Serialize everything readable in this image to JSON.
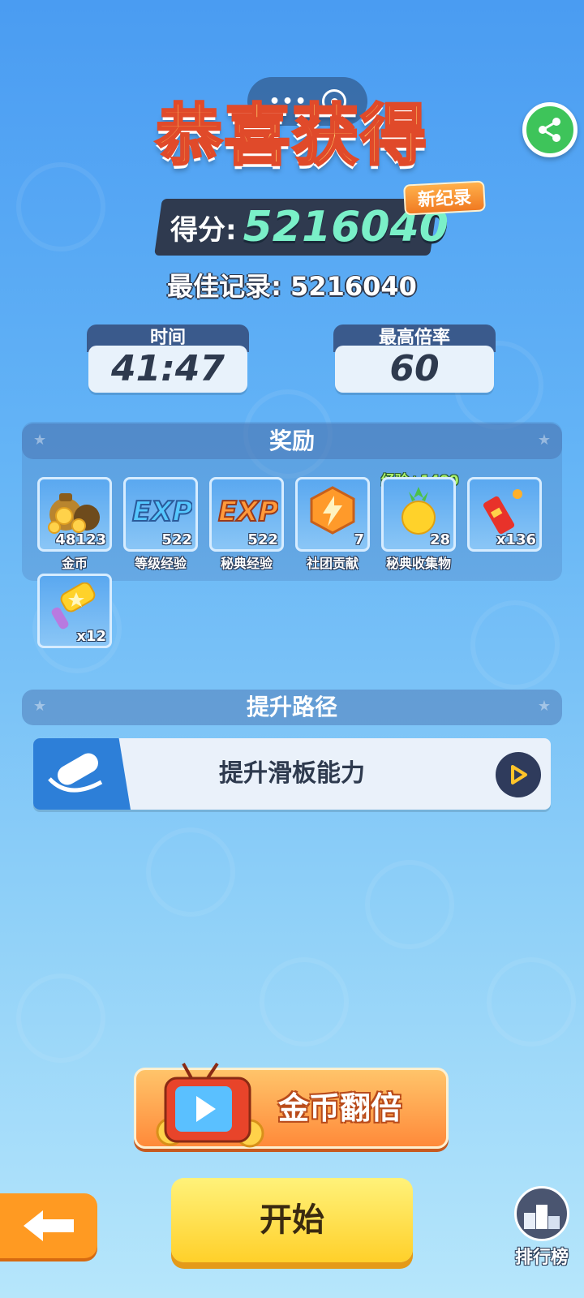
{
  "header": {
    "title": "恭喜获得"
  },
  "score": {
    "label": "得分:",
    "value": "5216040",
    "new_record_badge": "新纪录",
    "best_text": "最佳记录: 5216040"
  },
  "stats": [
    {
      "label": "时间",
      "value": "41:47"
    },
    {
      "label": "最高倍率",
      "value": "60"
    }
  ],
  "rewards": {
    "title": "奖励",
    "bonus_tag": "经验+1400",
    "items": [
      {
        "icon": "coin-bag-icon",
        "count": "48123",
        "label": "金币"
      },
      {
        "icon": "exp-blue-icon",
        "count": "522",
        "label": "等级经验",
        "icon_text": "EXP"
      },
      {
        "icon": "exp-orange-icon",
        "count": "522",
        "label": "秘典经验",
        "icon_text": "EXP"
      },
      {
        "icon": "lightning-badge-icon",
        "count": "7",
        "label": "社团贡献"
      },
      {
        "icon": "pineapple-icon",
        "count": "28",
        "label": "秘典收集物"
      },
      {
        "icon": "firecracker-icon",
        "count": "x136",
        "label": ""
      },
      {
        "icon": "hammer-icon",
        "count": "x12",
        "label": ""
      }
    ]
  },
  "upgrade": {
    "title": "提升路径",
    "card_label": "提升滑板能力"
  },
  "buttons": {
    "double_coins": "金币翻倍",
    "start": "开始",
    "leaderboard": "排行榜"
  },
  "colors": {
    "score_value": "#7af0c8",
    "new_record": "#f07a22",
    "start_button": "#ffd02a",
    "double_button": "#ff8a3a",
    "back_button": "#ff9a22"
  }
}
